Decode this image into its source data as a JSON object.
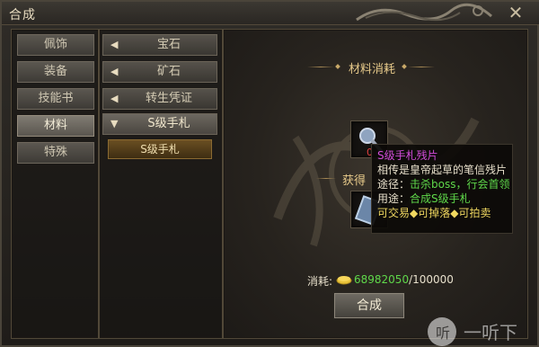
{
  "window": {
    "title": "合成",
    "close_icon": "close-icon"
  },
  "categories": [
    {
      "label": "佩饰",
      "active": false
    },
    {
      "label": "装备",
      "active": false
    },
    {
      "label": "技能书",
      "active": false
    },
    {
      "label": "材料",
      "active": true
    },
    {
      "label": "特殊",
      "active": false
    }
  ],
  "subcategories": [
    {
      "label": "宝石",
      "arrow": "◀",
      "open": false
    },
    {
      "label": "矿石",
      "arrow": "◀",
      "open": false
    },
    {
      "label": "转生凭证",
      "arrow": "◀",
      "open": false
    },
    {
      "label": "S级手札",
      "arrow": "▼",
      "open": true
    }
  ],
  "selected_leaf": {
    "label": "S级手札"
  },
  "recipe": {
    "materials_header": "材料消耗",
    "result_header": "获得",
    "material_count_prefix": "0",
    "cost_label": "消耗:",
    "cost_have": "68982050",
    "cost_sep": "/",
    "cost_need": "100000",
    "craft_button": "合成"
  },
  "tooltip": {
    "name": "S级手札残片",
    "desc": "相传是皇帝起草的笔信残片",
    "source_label": "途径：",
    "source_value": "击杀boss，行会首领",
    "use_label": "用途：",
    "use_value": "合成S级手札",
    "flags": "可交易◆可掉落◆可拍卖"
  },
  "watermark": {
    "text": "听 一听下"
  },
  "colors": {
    "accent_gold": "#e6c98a",
    "tooltip_name": "#d04bd8",
    "tooltip_green": "#5fd84a",
    "tooltip_flags": "#f0d860"
  }
}
